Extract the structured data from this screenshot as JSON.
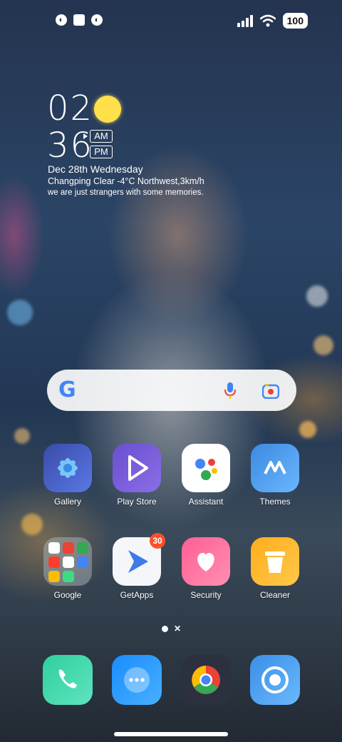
{
  "status_bar": {
    "notif_icons": [
      "camera-notification-icon",
      "square-notification-icon",
      "camera-notification-icon"
    ],
    "battery": "100"
  },
  "clock_widget": {
    "hour": "02",
    "minute": "36",
    "am": "AM",
    "pm": "PM",
    "selected_period": "AM",
    "date": "Dec 28th Wednesday",
    "weather": "Changping Clear -4°C Northwest,3km/h",
    "quote": "we are just strangers with some memories."
  },
  "search_bar": {
    "logo": "G",
    "icons": [
      "mic-icon",
      "lens-icon"
    ]
  },
  "apps_row1": [
    {
      "label": "Gallery",
      "icon": "gallery-icon",
      "color": "#5b6fd6"
    },
    {
      "label": "Play Store",
      "icon": "play-store-icon",
      "color": "#7a5bd6"
    },
    {
      "label": "Assistant",
      "icon": "assistant-icon",
      "color": "#ffffff"
    },
    {
      "label": "Themes",
      "icon": "themes-icon",
      "color": "#4a90e2"
    }
  ],
  "apps_row2": [
    {
      "label": "Google",
      "icon": "folder-icon"
    },
    {
      "label": "GetApps",
      "icon": "getapps-icon",
      "badge": "30"
    },
    {
      "label": "Security",
      "icon": "security-icon",
      "color": "#ff6f9a"
    },
    {
      "label": "Cleaner",
      "icon": "cleaner-icon",
      "color": "#ffb020"
    }
  ],
  "dock": [
    {
      "icon": "phone-icon",
      "color": "#3ed1a6"
    },
    {
      "icon": "messaging-icon",
      "color": "#1e9bff"
    },
    {
      "icon": "chrome-icon",
      "color": "#2c3140"
    },
    {
      "icon": "camera-icon",
      "color": "#4aa3ff"
    }
  ]
}
